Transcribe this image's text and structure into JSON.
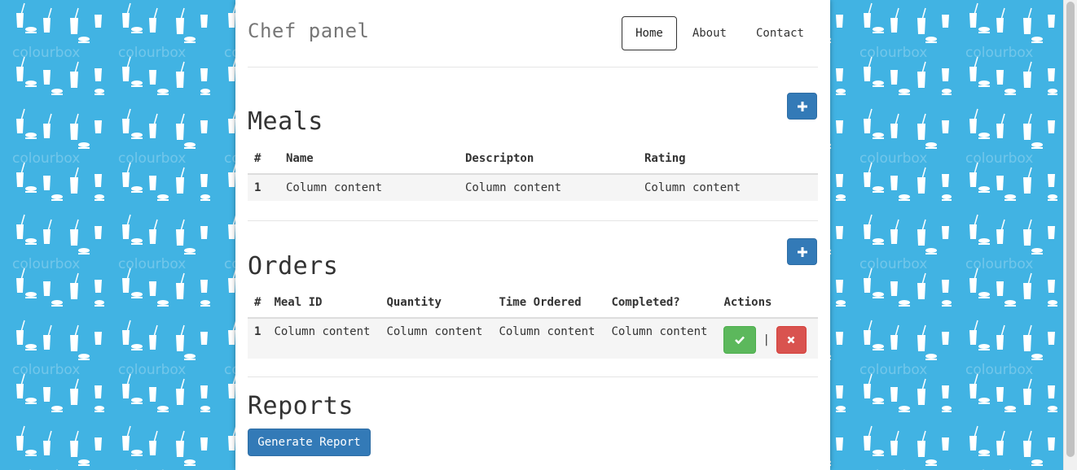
{
  "header": {
    "brand": "Chef panel",
    "nav": [
      {
        "label": "Home",
        "active": true
      },
      {
        "label": "About",
        "active": false
      },
      {
        "label": "Contact",
        "active": false
      }
    ]
  },
  "meals": {
    "title": "Meals",
    "columns": [
      "#",
      "Name",
      "Descripton",
      "Rating"
    ],
    "rows": [
      [
        "1",
        "Column content",
        "Column content",
        "Column content"
      ]
    ]
  },
  "orders": {
    "title": "Orders",
    "columns": [
      "#",
      "Meal ID",
      "Quantity",
      "Time Ordered",
      "Completed?",
      "Actions"
    ],
    "rows": [
      [
        "1",
        "Column content",
        "Column content",
        "Column content",
        "Column content"
      ]
    ],
    "action_separator": "|"
  },
  "reports": {
    "title": "Reports",
    "generate_label": "Generate Report"
  },
  "background": {
    "watermark": "colourbox"
  },
  "colors": {
    "background": "#41b3e3",
    "primary": "#337ab7",
    "success": "#5cb85c",
    "danger": "#d9534f"
  },
  "icons": {
    "add": "plus-icon",
    "complete": "check-icon",
    "delete": "times-icon"
  }
}
